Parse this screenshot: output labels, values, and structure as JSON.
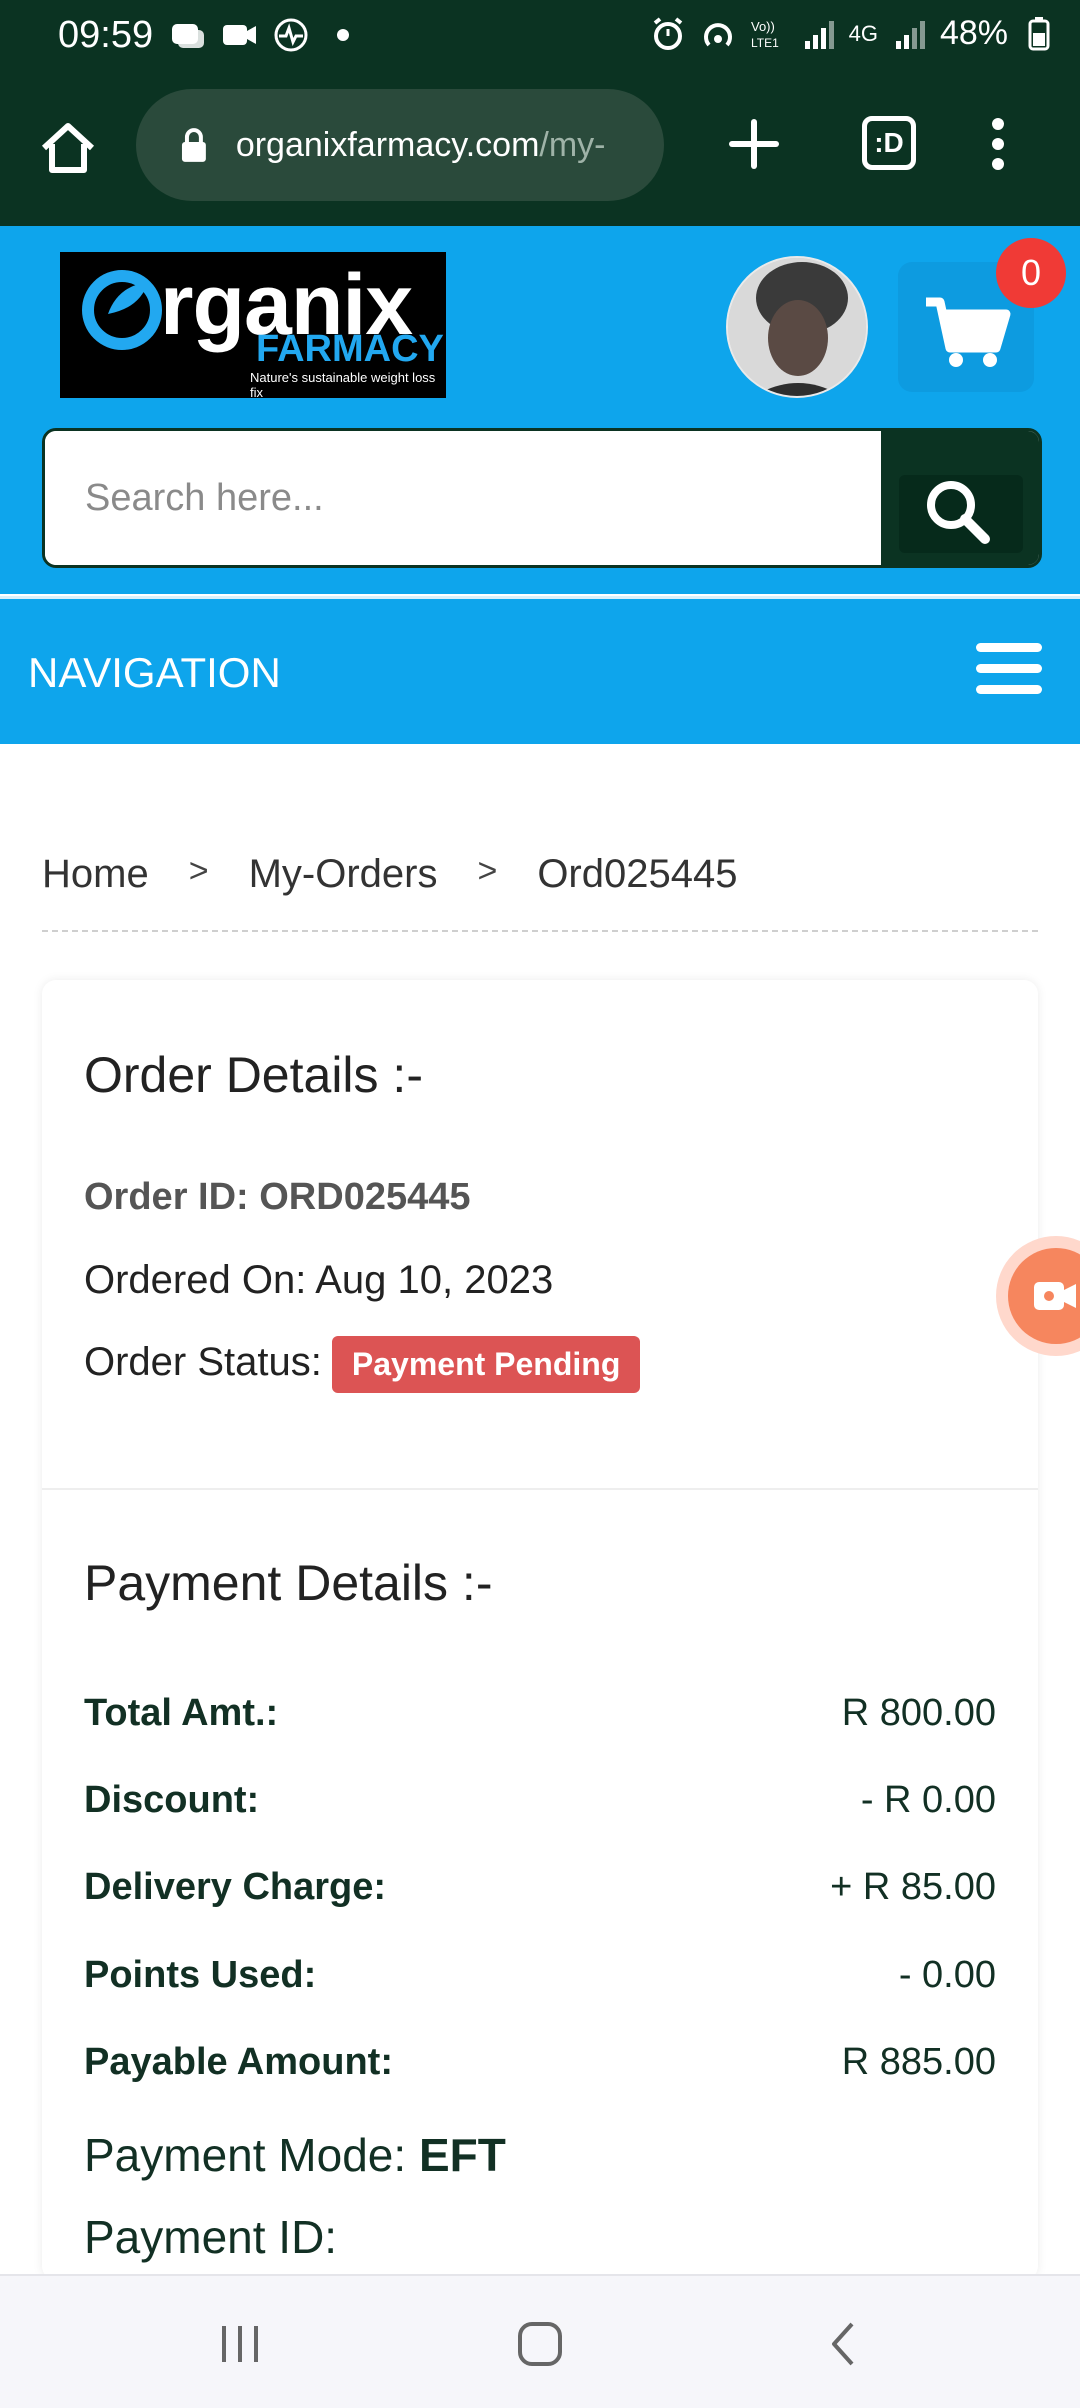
{
  "status_bar": {
    "time": "09:59",
    "battery": "48%",
    "network": "4G",
    "icons": [
      "chat-bubble-icon",
      "video-icon",
      "activity-icon",
      "dot-icon",
      "alarm-icon",
      "hotspot-icon",
      "volte-icon",
      "signal-icon",
      "signal-icon",
      "battery-icon"
    ]
  },
  "browser": {
    "url_domain": "organixfarmacy.com",
    "url_rest": "/my-",
    "tabs_label": ":D"
  },
  "header": {
    "logo_brand": "rganix",
    "logo_sub": "FARMACY",
    "logo_tagline": "Nature's sustainable weight loss fix",
    "cart_count": "0",
    "search_placeholder": "Search here..."
  },
  "nav": {
    "title": "NAVIGATION"
  },
  "breadcrumb": {
    "items": [
      "Home",
      "My-Orders",
      "Ord025445"
    ],
    "separator": ">"
  },
  "order_details": {
    "title": "Order Details :-",
    "order_id": "Order ID: ORD025445",
    "ordered_on": "Ordered On: Aug 10, 2023",
    "status_label": "Order Status:",
    "status_value": "Payment Pending"
  },
  "payment_details": {
    "title": "Payment Details :-",
    "rows": [
      {
        "label": "Total Amt.:",
        "value": "R 800.00"
      },
      {
        "label": "Discount:",
        "value": "- R 0.00"
      },
      {
        "label": "Delivery Charge:",
        "value": "+ R 85.00"
      },
      {
        "label": "Points Used:",
        "value": "- 0.00"
      },
      {
        "label": "Payable Amount:",
        "value": "R 885.00"
      }
    ],
    "mode_label": "Payment Mode:",
    "mode_value": "EFT",
    "payment_id_label": "Payment ID:"
  },
  "colors": {
    "dark_green": "#0b3322",
    "brand_blue": "#0ea5ec",
    "badge_red": "#dc5454",
    "cart_badge": "#f03a36"
  }
}
